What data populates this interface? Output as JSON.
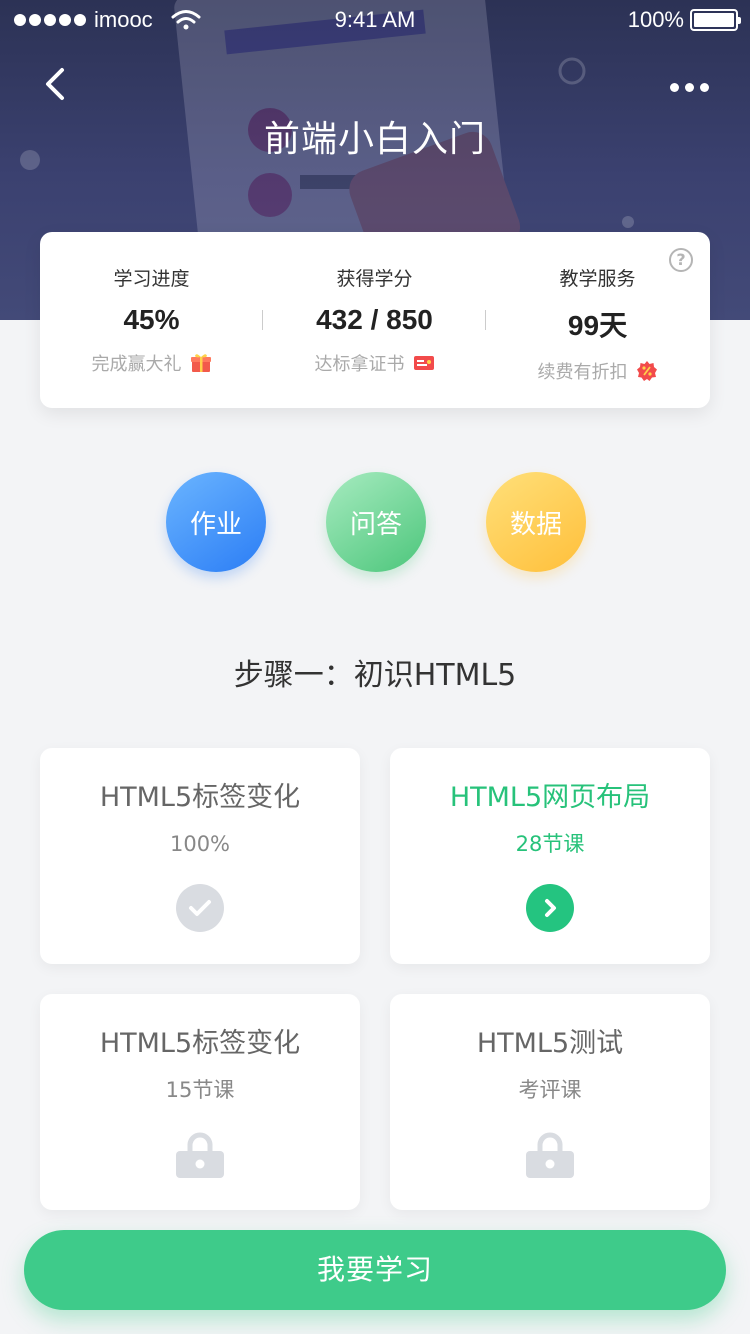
{
  "status_bar": {
    "carrier": "imooc",
    "time": "9:41 AM",
    "battery": "100%"
  },
  "header": {
    "title": "前端小白入门",
    "back_icon": "chevron-left-icon",
    "more_icon": "more-dots-icon",
    "background_color": "#3b4170"
  },
  "stats": {
    "progress": {
      "label": "学习进度",
      "value": "45%",
      "sub": "完成赢大礼",
      "icon": "gift-icon"
    },
    "credits": {
      "label": "获得学分",
      "value": "432 / 850",
      "sub": "达标拿证书",
      "icon": "certificate-icon"
    },
    "service": {
      "label": "教学服务",
      "value": "99天",
      "sub": "续费有折扣",
      "icon": "discount-badge-icon"
    },
    "help_icon": "question-circle-icon",
    "help_glyph": "?"
  },
  "actions": [
    {
      "label": "作业",
      "color": "#2b7df5"
    },
    {
      "label": "问答",
      "color": "#4cc67b"
    },
    {
      "label": "数据",
      "color": "#ffbf3a"
    }
  ],
  "step": {
    "title": "步骤一：初识HTML5"
  },
  "lessons": [
    {
      "title": "HTML5标签变化",
      "sub": "100%",
      "state": "completed",
      "icon": "check-circle-icon"
    },
    {
      "title": "HTML5网页布局",
      "sub": "28节课",
      "state": "active",
      "icon": "arrow-right-circle-icon"
    },
    {
      "title": "HTML5标签变化",
      "sub": "15节课",
      "state": "locked",
      "icon": "lock-icon"
    },
    {
      "title": "HTML5测试",
      "sub": "考评课",
      "state": "locked",
      "icon": "lock-icon"
    }
  ],
  "cta": {
    "label": "我要学习",
    "color": "#3ecb8a"
  },
  "colors": {
    "accent": "#27c27a",
    "page_bg": "#f3f4f6"
  }
}
